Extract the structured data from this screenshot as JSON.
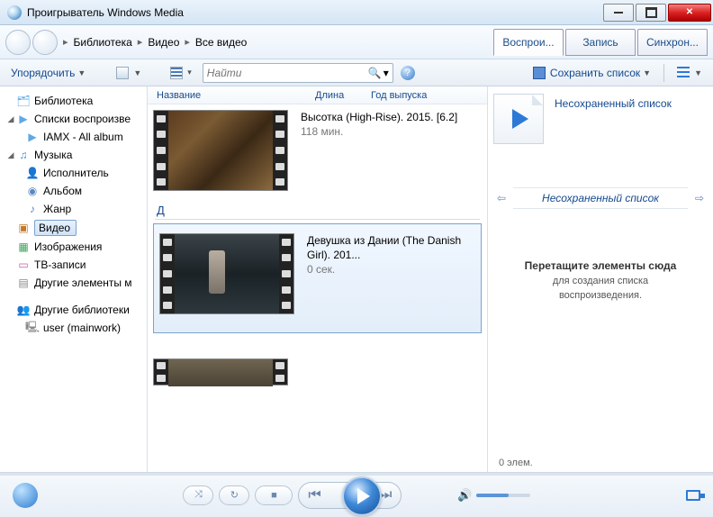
{
  "window": {
    "title": "Проигрыватель Windows Media"
  },
  "nav": {
    "crumbs": [
      "Библиотека",
      "Видео",
      "Все видео"
    ],
    "tabs": {
      "play": "Воспрои...",
      "burn": "Запись",
      "sync": "Синхрон..."
    }
  },
  "toolbar": {
    "organize": "Упорядочить",
    "search_placeholder": "Найти",
    "save_list": "Сохранить список"
  },
  "sidebar": {
    "library": "Библиотека",
    "playlists": "Списки воспроизве",
    "playlist_item": "IAMX - All album",
    "music": "Музыка",
    "artist": "Исполнитель",
    "album": "Альбом",
    "genre": "Жанр",
    "video": "Видео",
    "images": "Изображения",
    "tv": "ТВ-записи",
    "other_media": "Другие элементы м",
    "other_libs": "Другие библиотеки",
    "user": "user (mainwork)"
  },
  "columns": {
    "name": "Название",
    "length": "Длина",
    "year": "Год выпуска"
  },
  "videos": {
    "v1": {
      "title": "Высотка (High-Rise). 2015. [6.2]",
      "duration": "118 мин."
    },
    "group_letter": "Д",
    "v2": {
      "title": "Девушка из Дании (The Danish Girl). 201...",
      "duration": "0 сек."
    }
  },
  "rightpanel": {
    "unsaved": "Несохраненный список",
    "unsaved2": "Несохраненный список",
    "drag_title": "Перетащите элементы сюда",
    "drag_sub1": "для создания списка",
    "drag_sub2": "воспроизведения.",
    "count": "0 элем."
  }
}
